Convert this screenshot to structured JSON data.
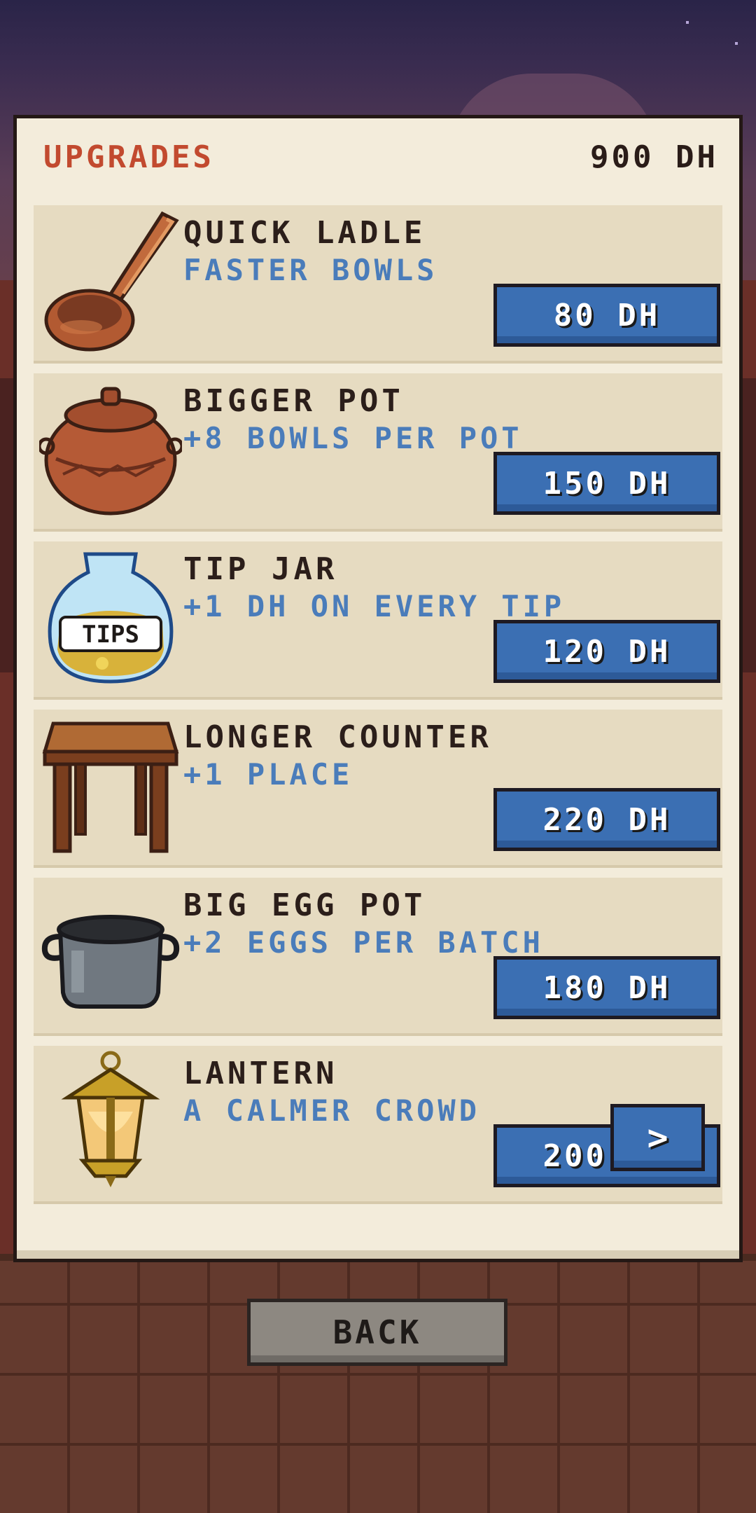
{
  "title": "UPGRADES",
  "money": "900 DH",
  "upgrades": [
    {
      "name": "QUICK LADLE",
      "desc": "FASTER BOWLS",
      "price": "80 DH",
      "icon": "ladle-icon"
    },
    {
      "name": "BIGGER POT",
      "desc": "+8 BOWLS PER POT",
      "price": "150 DH",
      "icon": "clay-pot-icon"
    },
    {
      "name": "TIP JAR",
      "desc": "+1 DH ON EVERY TIP",
      "price": "120 DH",
      "icon": "tip-jar-icon",
      "icon_label": "TIPS"
    },
    {
      "name": "LONGER COUNTER",
      "desc": "+1 PLACE",
      "price": "220 DH",
      "icon": "table-icon"
    },
    {
      "name": "BIG EGG POT",
      "desc": "+2 EGGS PER BATCH",
      "price": "180 DH",
      "icon": "cooking-pot-icon"
    },
    {
      "name": "LANTERN",
      "desc": "A CALMER CROWD",
      "price": "200 DH",
      "icon": "lantern-icon"
    }
  ],
  "next_label": ">",
  "back_label": "BACK",
  "colors": {
    "title": "#c24a2f",
    "desc": "#4a7cba",
    "button": "#3b6fb3",
    "panel": "#f3ecdb",
    "card": "#e6dbc1"
  }
}
